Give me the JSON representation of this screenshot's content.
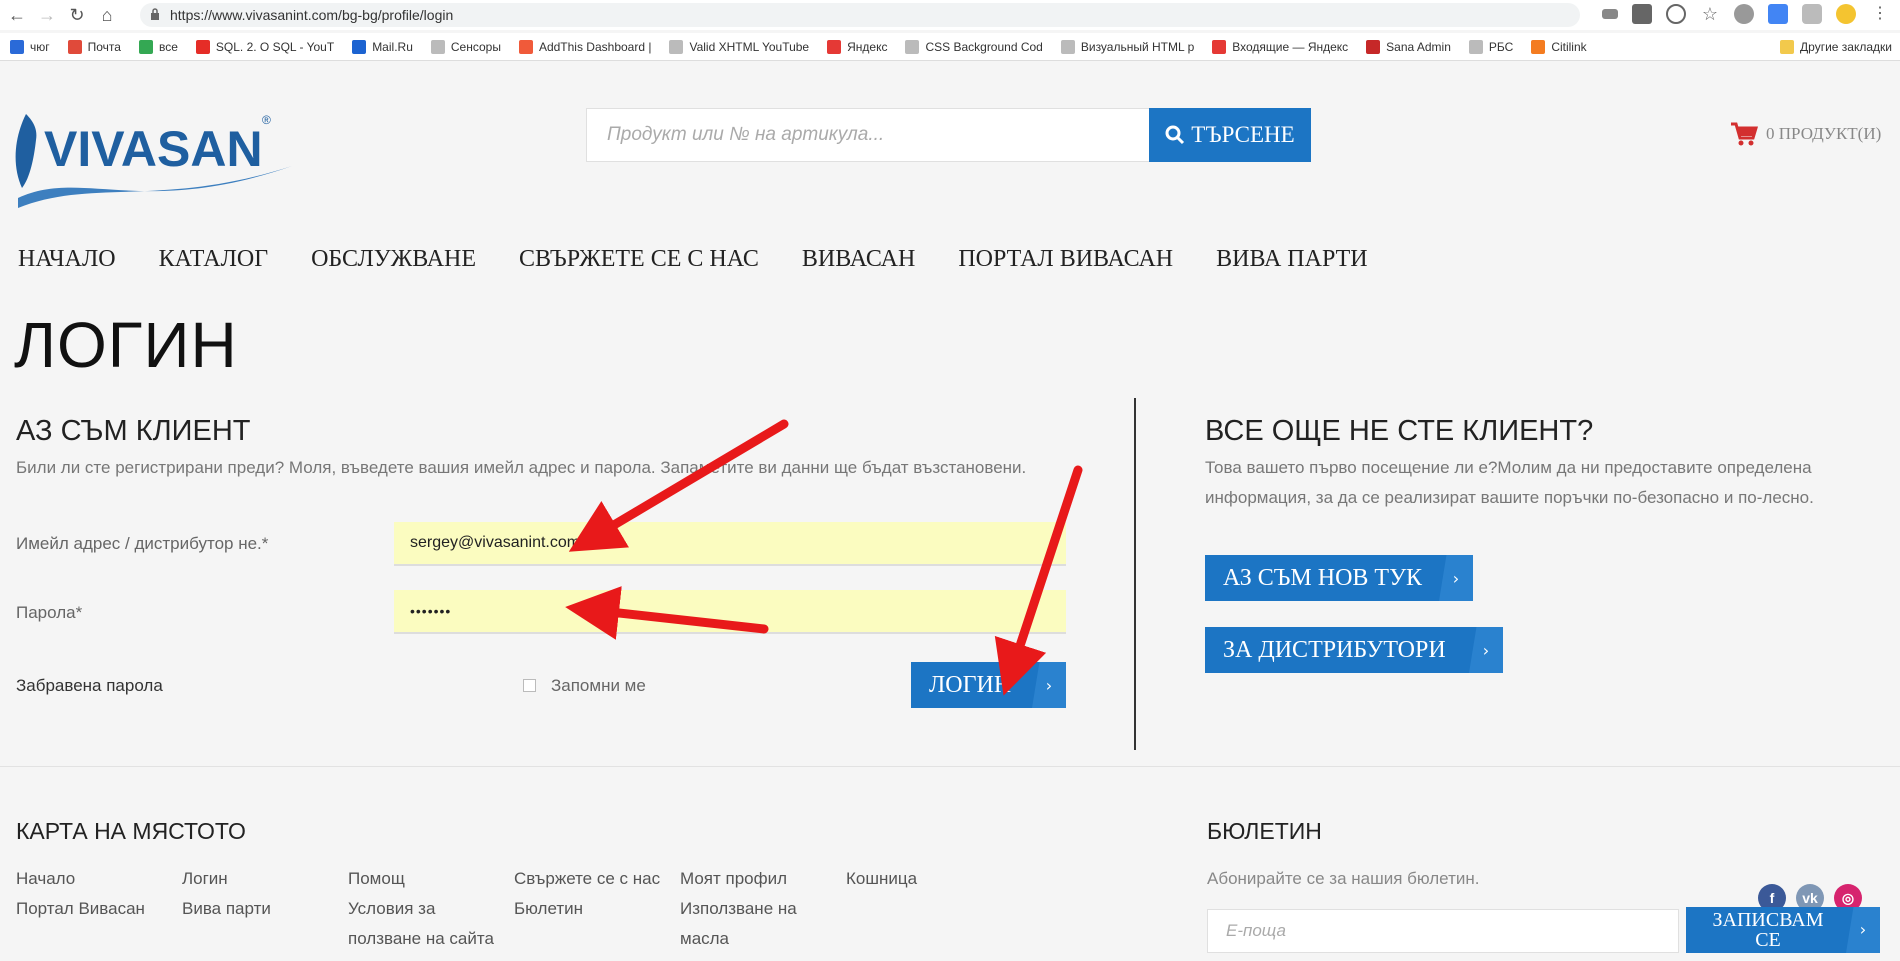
{
  "browser": {
    "url": "https://www.vivasanint.com/bg-bg/profile/login",
    "bookmarks": [
      {
        "label": "чюг",
        "color": "#2a6ad8"
      },
      {
        "label": "Почта",
        "color": "#e04a3a"
      },
      {
        "label": "все",
        "color": "#34a853"
      },
      {
        "label": "SQL. 2. O SQL - YouT",
        "color": "#e52d27"
      },
      {
        "label": "Mail.Ru",
        "color": "#1c63d1"
      },
      {
        "label": "Сенсоры",
        "color": "#bbb"
      },
      {
        "label": "AddThis Dashboard |",
        "color": "#f05a3a"
      },
      {
        "label": "Valid XHTML YouTube",
        "color": "#bbb"
      },
      {
        "label": "Яндекс",
        "color": "#e53935"
      },
      {
        "label": "CSS Background Cod",
        "color": "#bbb"
      },
      {
        "label": "Визуальный HTML р",
        "color": "#bbb"
      },
      {
        "label": "Входящие — Яндекс",
        "color": "#e53935"
      },
      {
        "label": "Sana Admin",
        "color": "#c62828"
      },
      {
        "label": "РБС",
        "color": "#bbb"
      },
      {
        "label": "Citilink",
        "color": "#f47c20"
      }
    ],
    "other_bookmarks": "Другие закладки"
  },
  "header": {
    "logo_text": "VIVASAN",
    "logo_mark": "®",
    "search_placeholder": "Продукт или № на артикула...",
    "search_button": "ТЪРСЕНЕ",
    "cart_text": "0 ПРОДУКТ(И)"
  },
  "nav": [
    "НАЧАЛО",
    "КАТАЛОГ",
    "ОБСЛУЖВАНЕ",
    "СВЪРЖЕТЕ СЕ С НАС",
    "ВИВАСАН",
    "ПОРТАЛ ВИВАСАН",
    "ВИВА ПАРТИ"
  ],
  "page_title": "ЛОГИН",
  "login": {
    "heading": "АЗ СЪМ КЛИЕНТ",
    "intro": "Били ли сте регистрирани преди? Моля, въведете вашия имейл адрес и парола. Запаметите ви данни ще бъдат възстановени.",
    "email_label": "Имейл адрес / дистрибутор не.*",
    "email_value": "sergey@vivasanint.com",
    "password_label": "Парола*",
    "password_value": "•••••••",
    "forgot_password": "Забравена парола",
    "remember_me": "Запомни ме",
    "login_button": "ЛОГИН"
  },
  "register": {
    "heading": "ВСЕ ОЩЕ НЕ СТЕ КЛИЕНТ?",
    "intro_line1": "Това вашето първо посещение ли е?Молим да ни предоставите определена",
    "intro_line2": "информация, за да се реализират вашите поръчки по-безопасно и по-лесно.",
    "new_button": "АЗ СЪМ НОВ ТУК",
    "distributor_button": "ЗА ДИСТРИБУТОРИ"
  },
  "footer": {
    "sitemap_heading": "КАРТА НА МЯСТОТО",
    "columns": [
      [
        "Начало",
        "Портал Вивасан"
      ],
      [
        "Логин",
        "Вива парти"
      ],
      [
        "Помощ",
        "Условия за",
        "ползване на сайта"
      ],
      [
        "Свържете се с нас",
        "Бюлетин"
      ],
      [
        "Моят профил",
        "Използване на",
        "масла"
      ],
      [
        "Кошница"
      ]
    ],
    "newsletter_heading": "БЮЛЕТИН",
    "newsletter_text": "Абонирайте се за нашия бюлетин.",
    "email_placeholder": "Е-поща",
    "subscribe_line1": "ЗАПИСВАМ",
    "subscribe_line2": "СЕ",
    "social": [
      {
        "name": "facebook-icon",
        "glyph": "f",
        "color": "#3b5998"
      },
      {
        "name": "vk-icon",
        "glyph": "vk",
        "color": "#7f97b5"
      },
      {
        "name": "instagram-icon",
        "glyph": "◎",
        "color": "#d6246e"
      }
    ]
  },
  "colors": {
    "accent": "#1c75c4",
    "arrow": "#e8191a",
    "autofill": "#fbfcc0"
  }
}
